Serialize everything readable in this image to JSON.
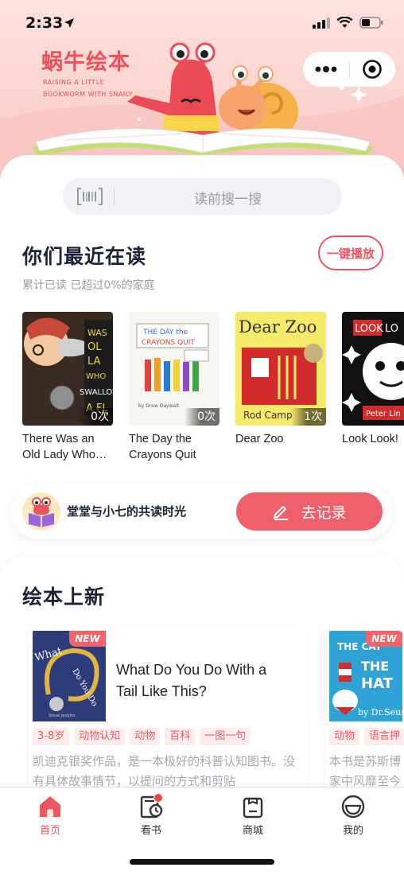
{
  "status": {
    "time": "2:33"
  },
  "brand": {
    "title": "蜗牛绘本",
    "subtitle": "RAISING A LITTLE BOOKWORM WITH SNAILY"
  },
  "search": {
    "placeholder": "读前搜一搜"
  },
  "recent": {
    "title": "你们最近在读",
    "play_all": "一键播放",
    "stat": "累计已读 已超过0%的家庭",
    "books": [
      {
        "title": "There Was an Old Lady Who Swallowed a Fly",
        "count": "0次"
      },
      {
        "title": "The Day the Crayons Quit",
        "count": "0次"
      },
      {
        "title": "Dear Zoo",
        "count": "1次"
      },
      {
        "title": "Look Look!",
        "count": ""
      }
    ]
  },
  "record": {
    "label": "堂堂与小七的共读时光",
    "button": "去记录"
  },
  "new_books": {
    "title": "绘本上新",
    "badge": "NEW",
    "items": [
      {
        "title": "What Do You Do With a Tail Like This?",
        "tags": [
          "3-8岁",
          "动物认知",
          "动物",
          "百科",
          "一图一句"
        ],
        "desc": "凯迪克银奖作品，是一本极好的科普认知图书。没有具体故事情节，以提问的方式和剪贴"
      },
      {
        "title": "",
        "tags": [
          "动物",
          "语言押"
        ],
        "desc": "本书是苏斯博家中风靡至今"
      }
    ]
  },
  "tabs": [
    {
      "label": "首页",
      "icon": "home-icon",
      "active": true
    },
    {
      "label": "看书",
      "icon": "book-clock-icon",
      "active": false
    },
    {
      "label": "商城",
      "icon": "shop-icon",
      "active": false
    },
    {
      "label": "我的",
      "icon": "smile-icon",
      "active": false
    }
  ],
  "colors": {
    "accent": "#f0565f",
    "button": "#f0606a",
    "hero_bg": "#fbd2cd",
    "tag_bg": "#fdecec"
  }
}
